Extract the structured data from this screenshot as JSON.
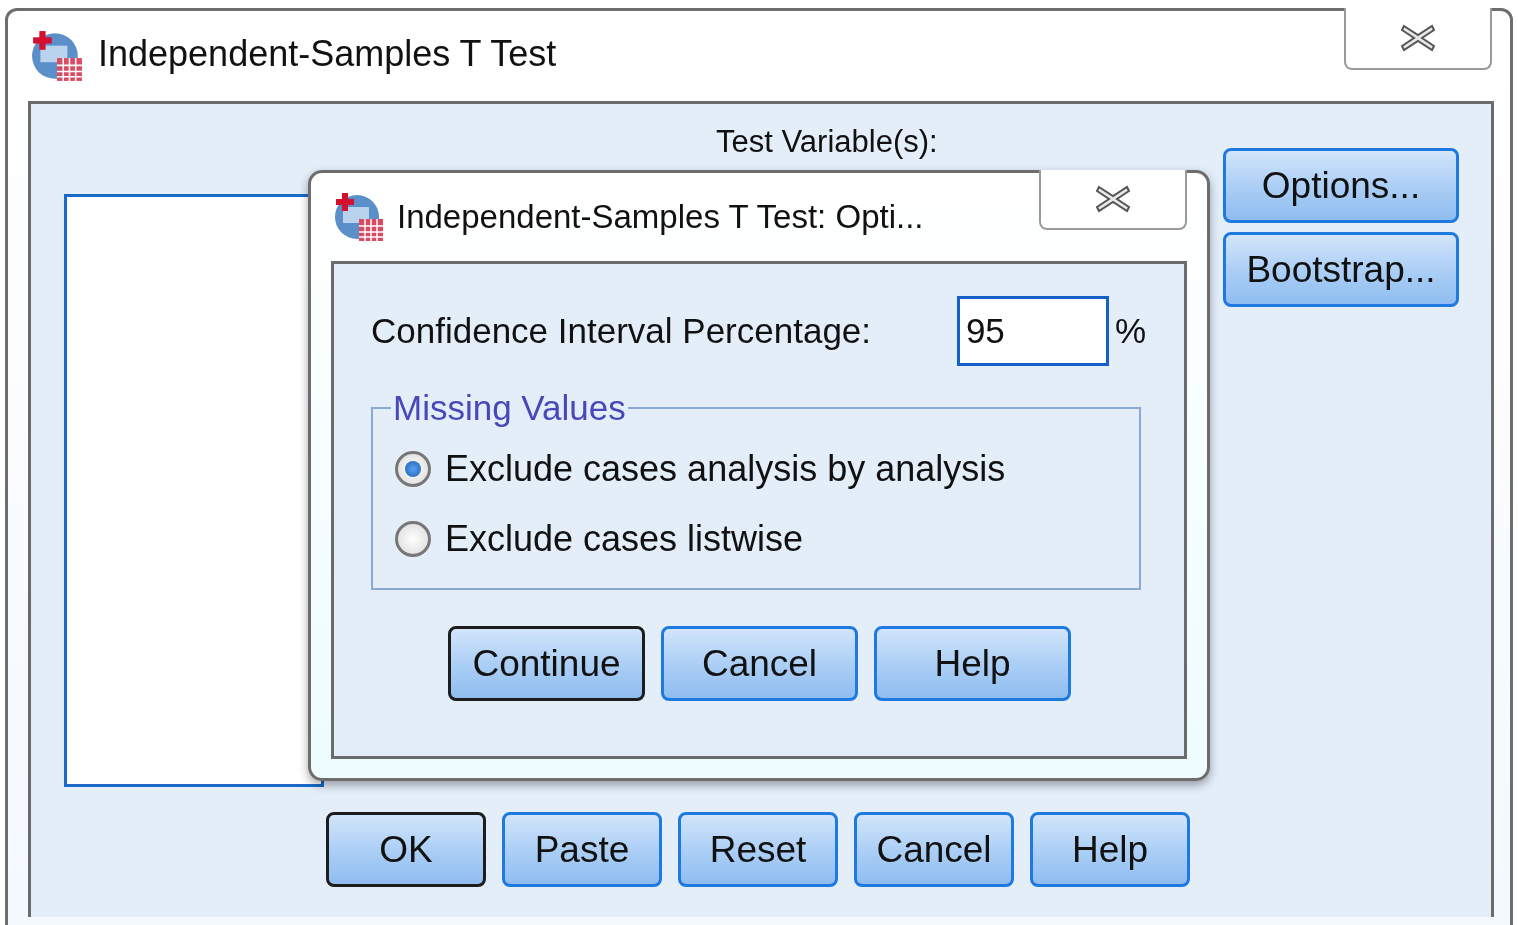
{
  "window": {
    "title": "Independent-Samples T Test"
  },
  "test_variables_label": "Test Variable(s):",
  "side_buttons": [
    "Options...",
    "Bootstrap..."
  ],
  "buttons": [
    {
      "label": "OK",
      "default": true
    },
    {
      "label": "Paste",
      "default": false
    },
    {
      "label": "Reset",
      "default": false
    },
    {
      "label": "Cancel",
      "default": false
    },
    {
      "label": "Help",
      "default": false
    }
  ],
  "dialog": {
    "title": "Independent-Samples T Test: Opti...",
    "confidence": {
      "label": "Confidence Interval Percentage:",
      "value": "95",
      "unit": "%"
    },
    "missing_values": {
      "legend": "Missing Values",
      "options": [
        {
          "label": "Exclude cases analysis by analysis",
          "selected": true
        },
        {
          "label": "Exclude cases listwise",
          "selected": false
        }
      ]
    },
    "buttons": [
      {
        "label": "Continue",
        "default": true
      },
      {
        "label": "Cancel",
        "default": false
      },
      {
        "label": "Help",
        "default": false
      }
    ]
  }
}
